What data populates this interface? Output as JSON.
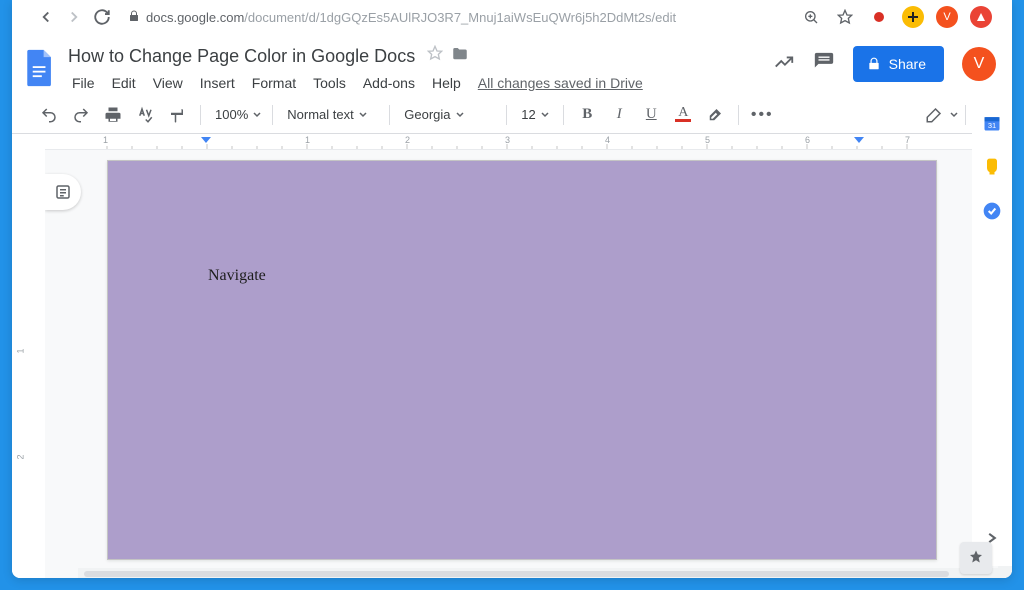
{
  "browser": {
    "url_domain": "docs.google.com",
    "url_path": "/document/d/1dgGQzEs5AUlRJO3R7_Mnuj1aiWsEuQWr6j5h2DdMt2s/edit",
    "avatar_letter": "V"
  },
  "doc": {
    "title": "How to Change Page Color in Google Docs",
    "save_status": "All changes saved in Drive",
    "body_text": "Navigate",
    "page_color": "#ad9ecb"
  },
  "menu": {
    "file": "File",
    "edit": "Edit",
    "view": "View",
    "insert": "Insert",
    "format": "Format",
    "tools": "Tools",
    "addons": "Add-ons",
    "help": "Help"
  },
  "toolbar": {
    "zoom": "100%",
    "style": "Normal text",
    "font": "Georgia",
    "font_size": "12",
    "share_label": "Share",
    "avatar_letter": "V"
  },
  "ruler": {
    "h_numbers": [
      "1",
      "1",
      "2",
      "3",
      "4",
      "5",
      "6",
      "7"
    ],
    "v_numbers": [
      "1",
      "2"
    ]
  }
}
